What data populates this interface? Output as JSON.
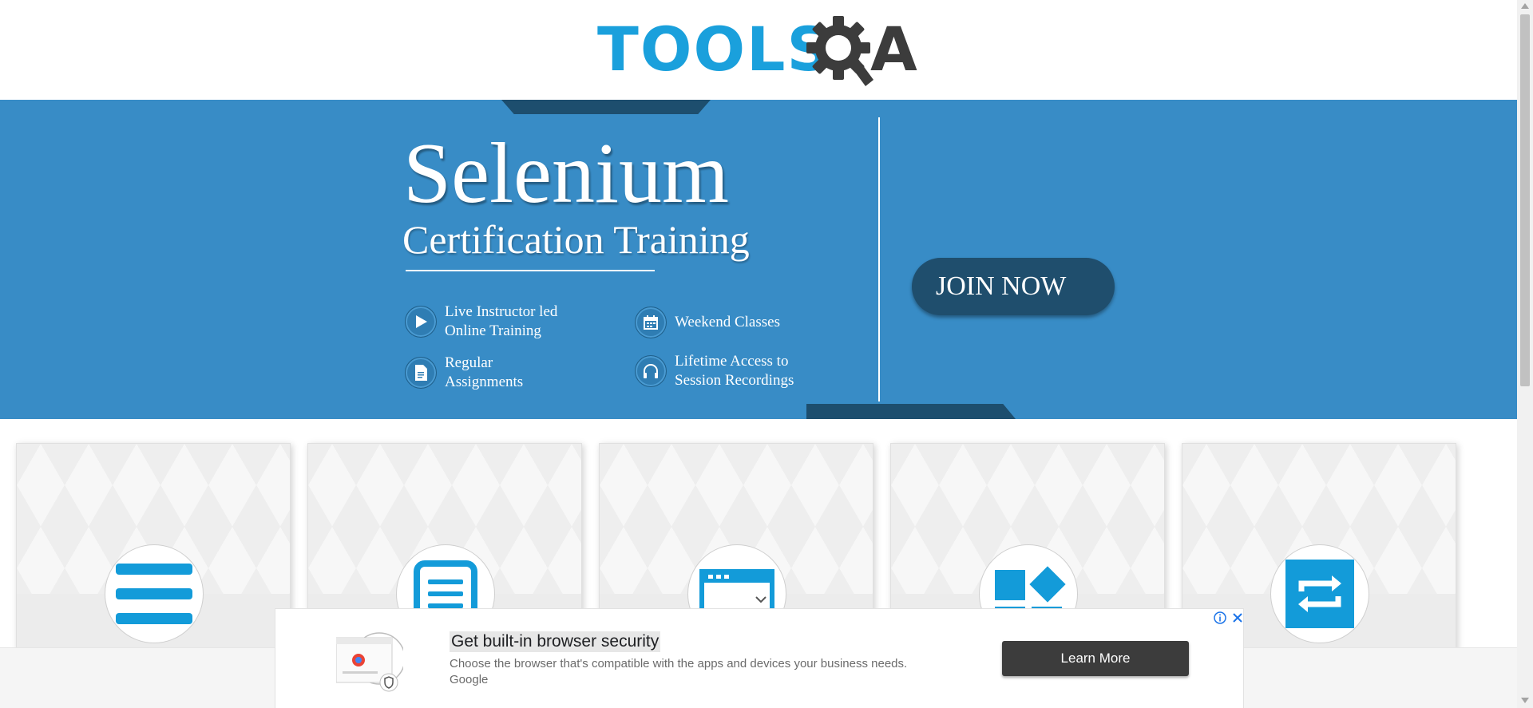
{
  "header": {
    "logo_text": "TOOLS",
    "logo_suffix": "A"
  },
  "banner": {
    "title": "Selenium",
    "subtitle": "Certification Training",
    "features": [
      {
        "line1": "Live Instructor led",
        "line2": "Online Training",
        "icon": "play-icon"
      },
      {
        "line1": "Weekend Classes",
        "line2": "",
        "icon": "calendar-icon"
      },
      {
        "line1": "Regular",
        "line2": "Assignments",
        "icon": "document-icon"
      },
      {
        "line1": "Lifetime Access to",
        "line2": "Session Recordings",
        "icon": "headphones-icon"
      }
    ],
    "join_label": "JOIN NOW"
  },
  "cards": [
    {
      "icon": "hamburger-menu-icon"
    },
    {
      "icon": "form-document-icon"
    },
    {
      "icon": "browser-window-icon"
    },
    {
      "icon": "widgets-icon"
    },
    {
      "icon": "interaction-arrows-icon"
    }
  ],
  "ad": {
    "title": "Get built-in browser security",
    "description": "Choose the browser that's compatible with the apps and devices your business needs.",
    "advertiser": "Google",
    "cta_label": "Learn More"
  },
  "colors": {
    "brand_blue": "#1aa0dc",
    "banner_blue": "#388cc6",
    "banner_dark": "#1f4e6d"
  }
}
